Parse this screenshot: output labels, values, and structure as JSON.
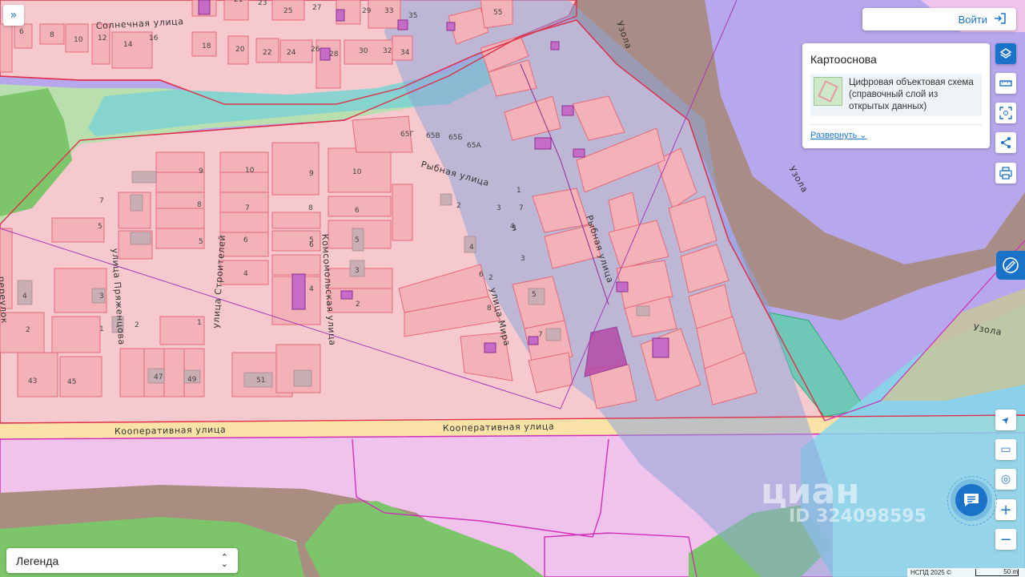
{
  "map": {
    "streets": {
      "solnechnaya": "Солнечная улица",
      "rybnaya_1": "Рыбная улица",
      "rybnaya_2": "Рыбная улица",
      "komsomolskaya": "Комсомольская улица",
      "stroiteley": "улица Строителей",
      "pryazhentsova": "улица Пряженцова",
      "mira": "улица Мира",
      "kooperativnaya_1": "Кооперативная улица",
      "kooperativnaya_2": "Кооперативная улица",
      "pereulok": "переулок",
      "uzola_1": "Узола",
      "uzola_2": "Узола",
      "uzola_3": "Узола"
    },
    "house_numbers": [
      "6",
      "8",
      "10",
      "12",
      "14",
      "16",
      "18",
      "20",
      "22",
      "24",
      "26",
      "28",
      "30",
      "32",
      "34",
      "21",
      "23",
      "25",
      "27",
      "29",
      "33",
      "35",
      "55",
      "65Г",
      "65В",
      "65Б",
      "65А",
      "9",
      "10",
      "9",
      "10",
      "7",
      "8",
      "7",
      "8",
      "6",
      "6",
      "5",
      "5",
      "5",
      "5",
      "6",
      "4",
      "4",
      "3",
      "4",
      "3",
      "2",
      "2",
      "1",
      "2",
      "1",
      "43",
      "45",
      "47",
      "49",
      "51",
      "7",
      "5",
      "3",
      "2",
      "1",
      "2",
      "4",
      "6",
      "8",
      "3",
      "5",
      "7",
      "1",
      "4",
      "1"
    ],
    "colors": {
      "residential_zone": "#f6c9cf",
      "zone_border": "#e0304a",
      "purple_zone": "#b7a7ec",
      "public_zone": "#f0c3ec",
      "green_zone": "#7dc56b",
      "water": "#7fd3d0",
      "brown_zone": "#b58a6b",
      "road": "#fbe3a8",
      "parcel_fill": "#f3b1b8",
      "parcel_border": "#e56a78"
    }
  },
  "ui": {
    "expand_button": "»",
    "login": {
      "label": "Войти"
    },
    "basemap": {
      "title": "Картооснова",
      "item": "Цифровая объектовая схема (справочный слой из открытых данных)",
      "expand": "Развернуть"
    },
    "legend": {
      "label": "Легенда",
      "arrow": "⌃⌄"
    },
    "toolbar": {
      "layers_icon": "layers-icon",
      "ruler_icon": "ruler-icon",
      "select_icon": "select-area-icon",
      "share_icon": "share-icon",
      "print_icon": "print-icon"
    },
    "right_controls": {
      "locate": "➤",
      "minimap": "▭",
      "geo": "◎",
      "zoom_in": "+",
      "zoom_out": "−"
    },
    "watermark": "циан",
    "watermark_id": "ID 324098595",
    "attribution": "НСПД 2025 ©",
    "scale": "50 m"
  }
}
